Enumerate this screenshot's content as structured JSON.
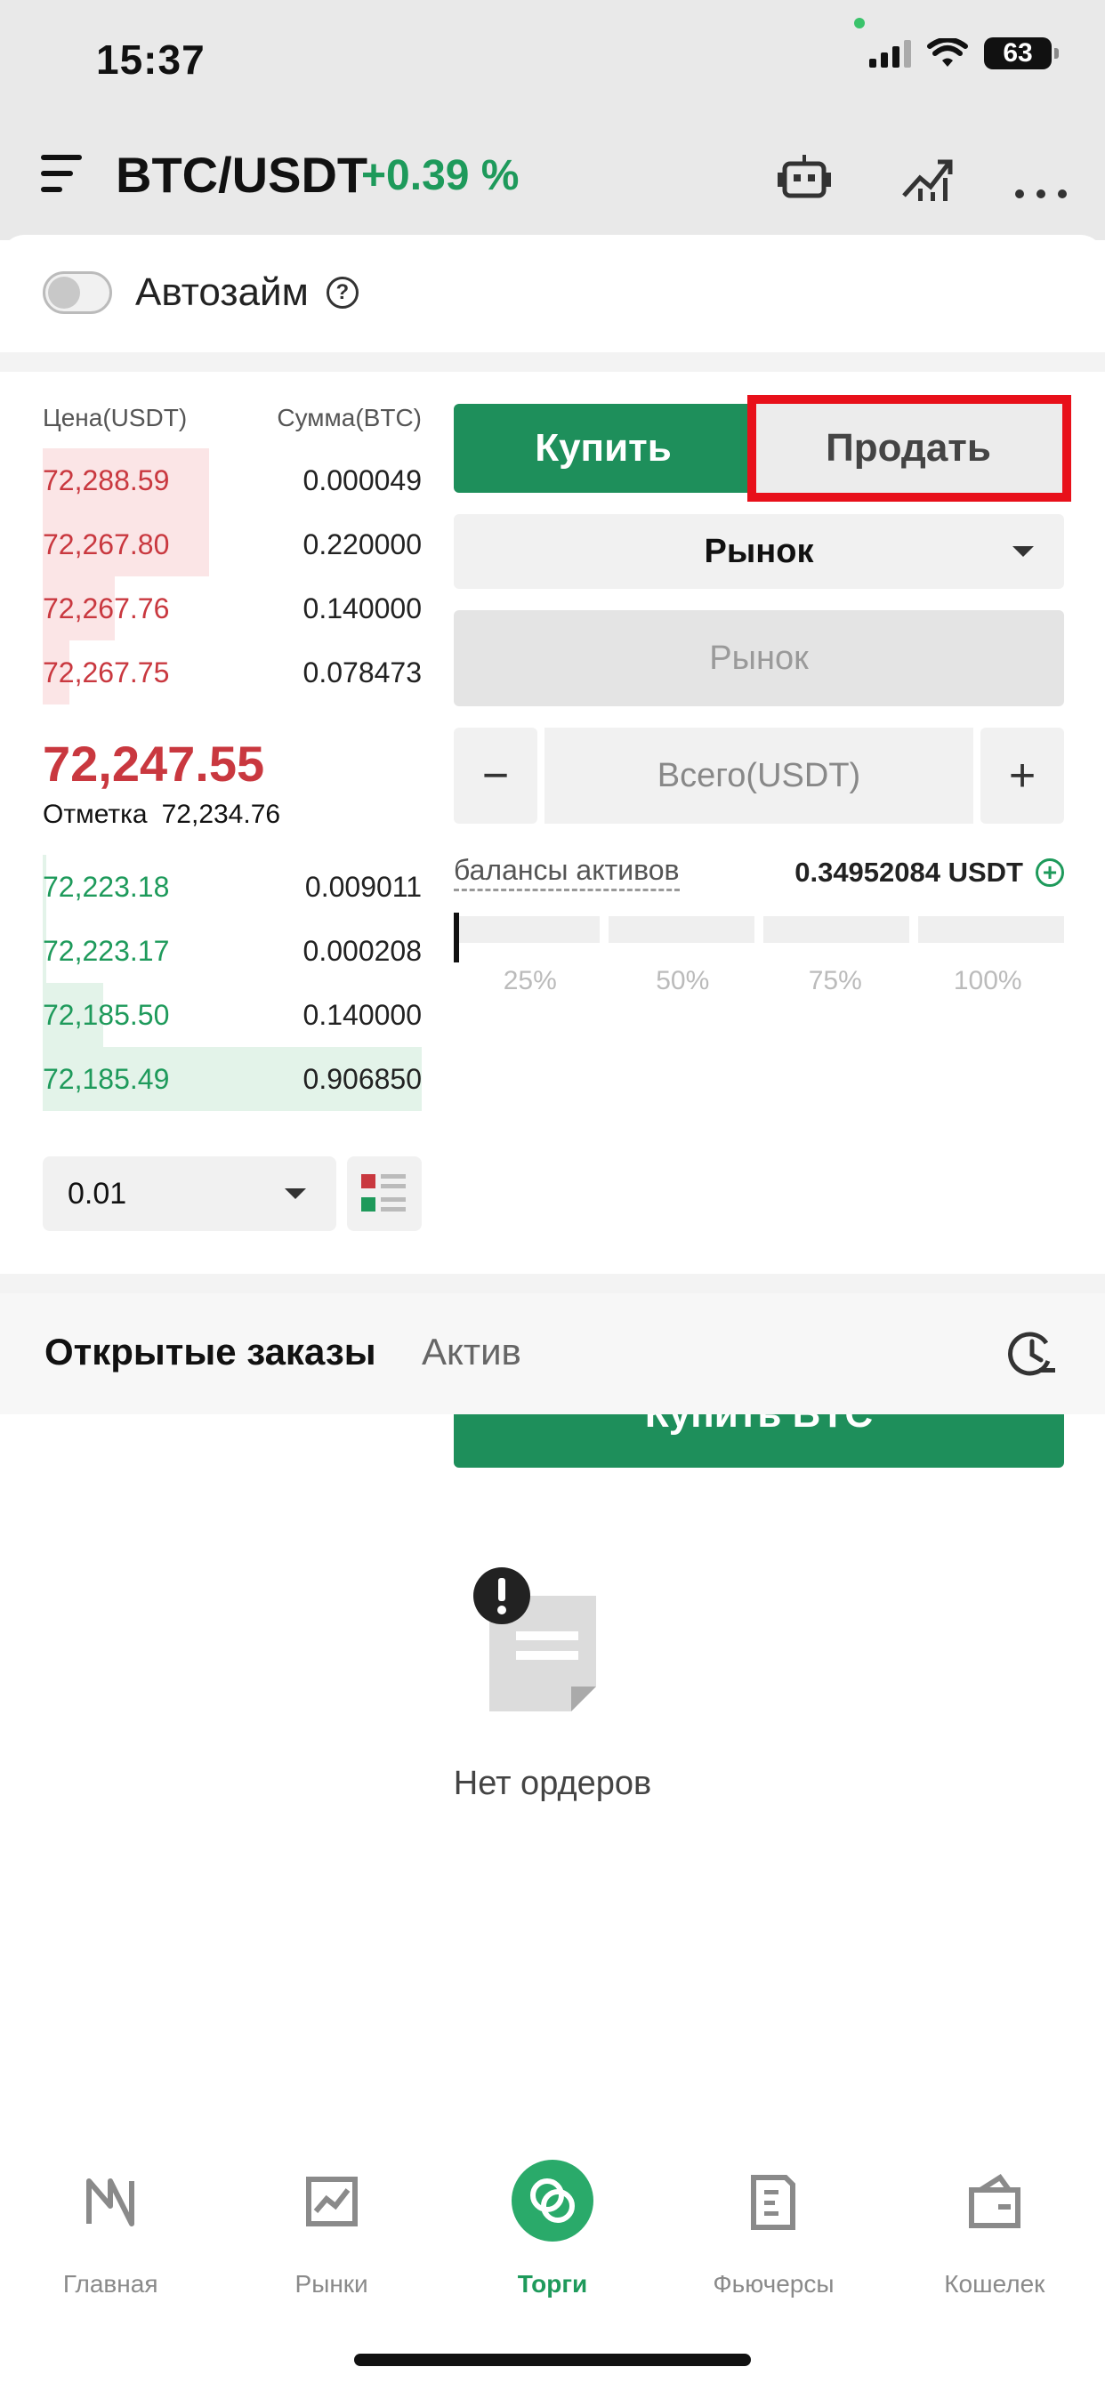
{
  "status_bar": {
    "time": "15:37",
    "battery": "63"
  },
  "header": {
    "pair": "BTC/USDT",
    "change": "+0.39 %"
  },
  "autoloan": {
    "label": "Автозайм",
    "help": "?"
  },
  "order_book": {
    "price_header": "Цена(USDT)",
    "amount_header": "Сумма(BTC)",
    "asks": [
      {
        "price": "72,288.59",
        "amount": "0.000049",
        "depth": 0.44
      },
      {
        "price": "72,267.80",
        "amount": "0.220000",
        "depth": 0.44
      },
      {
        "price": "72,267.76",
        "amount": "0.140000",
        "depth": 0.19
      },
      {
        "price": "72,267.75",
        "amount": "0.078473",
        "depth": 0.07
      }
    ],
    "last_price": "72,247.55",
    "mark_label": "Отметка",
    "mark_price": "72,234.76",
    "bids": [
      {
        "price": "72,223.18",
        "amount": "0.009011",
        "depth": 0.01
      },
      {
        "price": "72,223.17",
        "amount": "0.000208",
        "depth": 0.01
      },
      {
        "price": "72,185.50",
        "amount": "0.140000",
        "depth": 0.16
      },
      {
        "price": "72,185.49",
        "amount": "0.906850",
        "depth": 1.0
      }
    ],
    "precision": "0.01"
  },
  "form": {
    "buy_tab": "Купить",
    "sell_tab": "Продать",
    "order_type": "Рынок",
    "price_placeholder": "Рынок",
    "minus": "−",
    "total_placeholder": "Всего(USDT)",
    "plus": "+",
    "balance_label": "балансы активов",
    "balance_value": "0.34952084 USDT",
    "percents": [
      "25%",
      "50%",
      "75%",
      "100%"
    ],
    "submit": "Купить BTC"
  },
  "orders": {
    "tab_open": "Открытые заказы",
    "tab_assets": "Актив",
    "empty_text": "Нет ордеров"
  },
  "nav": [
    {
      "label": "Главная",
      "icon": "home-icon"
    },
    {
      "label": "Рынки",
      "icon": "markets-icon"
    },
    {
      "label": "Торги",
      "icon": "trade-icon"
    },
    {
      "label": "Фьючерсы",
      "icon": "futures-icon"
    },
    {
      "label": "Кошелек",
      "icon": "wallet-icon"
    }
  ],
  "colors": {
    "green": "#1e8f5b",
    "red": "#c9383f",
    "highlight": "#e8101a"
  }
}
